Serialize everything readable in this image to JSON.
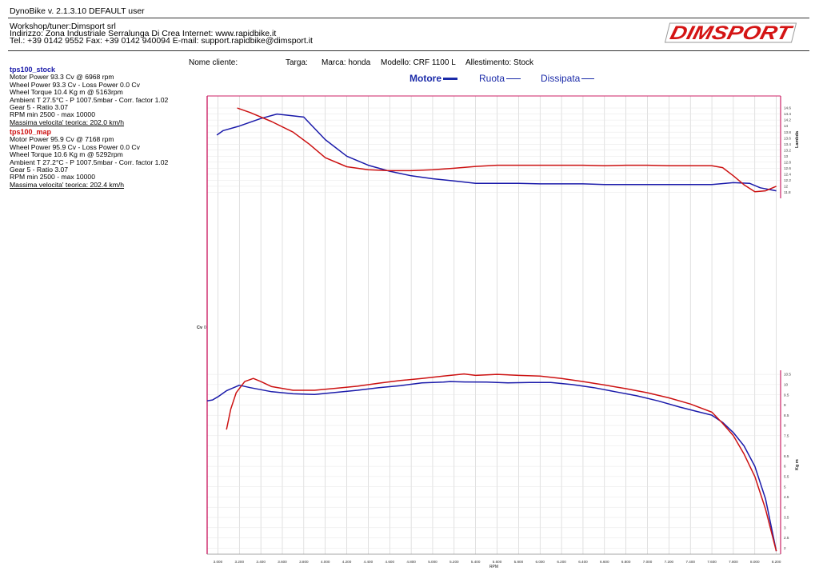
{
  "header": {
    "app_title": "DynoBike v. 2.1.3.10   DEFAULT user",
    "workshop": "Workshop/tuner:Dimsport srl",
    "address": "Indirizzo: Zona Industriale Serralunga Di Crea Internet: www.rapidbike.it",
    "contacts": "Tel.: +39 0142 9552 Fax: +39 0142 940094 E-mail: support.rapidbike@dimsport.it",
    "logo_text": "DIMSPORT"
  },
  "meta": {
    "cliente": "Nome cliente:",
    "targa": "Targa:",
    "marca": "Marca: honda",
    "modello": "Modello: CRF 1100 L",
    "allestimento": "Allestimento: Stock"
  },
  "legend": {
    "motore": "Motore",
    "ruota": "Ruota",
    "dissipata": "Dissipata"
  },
  "runs": [
    {
      "name": "tps100_stock",
      "color": "#1a1aaa",
      "lines": [
        "Motor Power 93.3 Cv  @ 6968 rpm",
        "Wheel Power 93.3 Cv  - Loss Power 0.0 Cv",
        "Wheel Torque 10.4 Kg m  @ 5163rpm",
        "Ambient T 27.5°C - P 1007.5mbar - Corr. factor 1.02",
        "Gear 5 - Ratio 3.07",
        "RPM min 2500 - max 10000"
      ],
      "speed": "Massima velocita' teorica: 202.0 km/h"
    },
    {
      "name": "tps100_map",
      "color": "#cc1111",
      "lines": [
        "Motor Power 95.9 Cv  @ 7168 rpm",
        "Wheel Power 95.9 Cv  - Loss Power 0.0 Cv",
        "Wheel Torque 10.6 Kg m  @ 5292rpm",
        "Ambient T 27.2°C - P 1007.5mbar - Corr. factor 1.02",
        "Gear 5 - Ratio 3.07",
        "RPM min 2500 - max 10000"
      ],
      "speed": "Massima velocita' teorica: 202.4 km/h"
    }
  ],
  "colors": {
    "stock": "#1a1aaa",
    "map": "#cc1111",
    "axis": "#cc2266",
    "grid": "#cccccc"
  },
  "chart_data": {
    "type": "line",
    "xlabel": "RPM",
    "x_ticks": [
      "3.000",
      "3.200",
      "3.400",
      "3.600",
      "3.800",
      "4.000",
      "4.200",
      "4.400",
      "4.600",
      "4.800",
      "5.000",
      "5.200",
      "5.400",
      "5.600",
      "5.800",
      "6.000",
      "6.200",
      "6.400",
      "6.600",
      "6.800",
      "7.000",
      "7.200",
      "7.400",
      "7.600",
      "7.800",
      "8.000",
      "8.200"
    ],
    "xlim": [
      2900,
      8240
    ],
    "left_axis_label": "Cv",
    "left_axis_tick": "0",
    "lambda": {
      "label": "Lambda",
      "ylim": [
        11.6,
        15.0
      ],
      "ticks": [
        "14.6",
        "14.4",
        "14.2",
        "14",
        "13.8",
        "13.6",
        "13.4",
        "13.2",
        "13",
        "12.8",
        "12.6",
        "12.4",
        "12.2",
        "12",
        "11.8"
      ],
      "series": [
        {
          "name": "tps100_stock",
          "x": [
            2990,
            3050,
            3200,
            3400,
            3550,
            3800,
            4000,
            4200,
            4400,
            4600,
            4800,
            5000,
            5200,
            5400,
            5600,
            5800,
            6000,
            6200,
            6400,
            6600,
            6800,
            7000,
            7200,
            7400,
            7600,
            7800,
            7950,
            8050,
            8200
          ],
          "y": [
            13.7,
            13.85,
            14.0,
            14.25,
            14.4,
            14.3,
            13.55,
            13.0,
            12.7,
            12.5,
            12.35,
            12.25,
            12.18,
            12.1,
            12.1,
            12.1,
            12.08,
            12.08,
            12.08,
            12.06,
            12.06,
            12.06,
            12.06,
            12.06,
            12.06,
            12.12,
            12.1,
            11.95,
            11.85
          ]
        },
        {
          "name": "tps100_map",
          "x": [
            3180,
            3300,
            3500,
            3700,
            3850,
            4000,
            4200,
            4400,
            4600,
            4800,
            5000,
            5200,
            5400,
            5600,
            5800,
            6000,
            6200,
            6400,
            6600,
            6800,
            7000,
            7200,
            7400,
            7600,
            7700,
            7800,
            7900,
            8000,
            8100,
            8200
          ],
          "y": [
            14.6,
            14.45,
            14.15,
            13.8,
            13.4,
            12.95,
            12.65,
            12.55,
            12.52,
            12.52,
            12.55,
            12.6,
            12.66,
            12.7,
            12.7,
            12.7,
            12.7,
            12.7,
            12.68,
            12.7,
            12.7,
            12.68,
            12.68,
            12.68,
            12.62,
            12.35,
            12.05,
            11.82,
            11.85,
            12.0
          ]
        }
      ]
    },
    "torque": {
      "label": "Kg m",
      "ylim": [
        1.7,
        10.7
      ],
      "ticks": [
        "10.5",
        "10",
        "9.5",
        "9",
        "8.5",
        "8",
        "7.5",
        "7",
        "6.5",
        "6",
        "5.5",
        "5",
        "4.5",
        "4",
        "3.5",
        "3",
        "2.5",
        "2"
      ],
      "series": [
        {
          "name": "tps100_stock",
          "x": [
            2900,
            2950,
            3000,
            3080,
            3200,
            3300,
            3500,
            3700,
            3900,
            4100,
            4300,
            4500,
            4700,
            4900,
            5100,
            5163,
            5300,
            5500,
            5700,
            5900,
            6100,
            6300,
            6500,
            6700,
            6900,
            7100,
            7300,
            7450,
            7600,
            7700,
            7800,
            7900,
            8000,
            8100,
            8200
          ],
          "y": [
            9.2,
            9.25,
            9.4,
            9.7,
            9.97,
            9.85,
            9.65,
            9.55,
            9.52,
            9.62,
            9.72,
            9.85,
            9.95,
            10.08,
            10.12,
            10.15,
            10.13,
            10.12,
            10.08,
            10.1,
            10.1,
            10.0,
            9.85,
            9.65,
            9.45,
            9.2,
            8.9,
            8.7,
            8.5,
            8.15,
            7.65,
            7.0,
            6.0,
            4.4,
            1.85
          ]
        },
        {
          "name": "tps100_map",
          "x": [
            3080,
            3120,
            3170,
            3250,
            3330,
            3400,
            3500,
            3700,
            3900,
            4100,
            4300,
            4500,
            4700,
            4900,
            5100,
            5292,
            5400,
            5600,
            5800,
            6000,
            6200,
            6400,
            6600,
            6800,
            7000,
            7200,
            7400,
            7600,
            7700,
            7800,
            7900,
            8000,
            8100,
            8200
          ],
          "y": [
            7.8,
            8.8,
            9.6,
            10.15,
            10.3,
            10.15,
            9.9,
            9.72,
            9.72,
            9.82,
            9.92,
            10.07,
            10.2,
            10.3,
            10.42,
            10.52,
            10.45,
            10.5,
            10.45,
            10.42,
            10.3,
            10.15,
            9.98,
            9.8,
            9.6,
            9.35,
            9.05,
            8.65,
            8.1,
            7.5,
            6.6,
            5.5,
            3.9,
            1.85
          ]
        }
      ]
    }
  }
}
